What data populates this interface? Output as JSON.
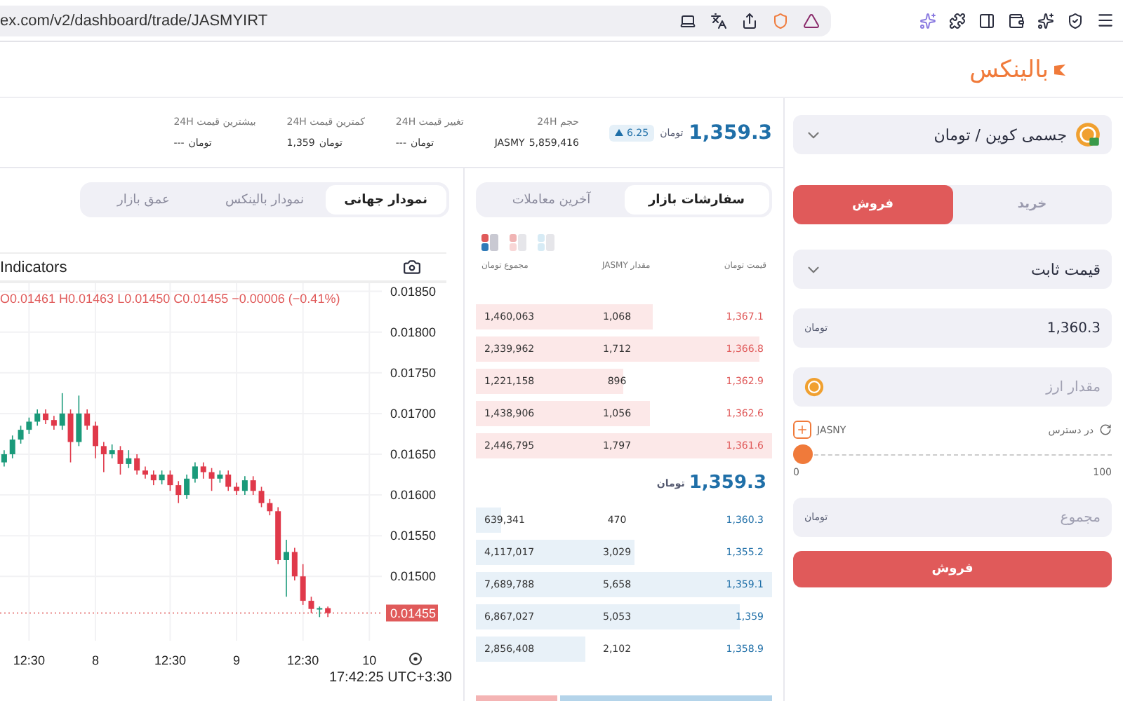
{
  "browser": {
    "url": "ex.com/v2/dashboard/trade/JASMYIRT"
  },
  "logo": {
    "text": "بالینکس"
  },
  "order_form": {
    "pair": "جسمی کوین / تومان",
    "sides": [
      {
        "label": "خرید",
        "selected": false
      },
      {
        "label": "فروش",
        "selected": true
      }
    ],
    "order_type": "قیمت ثابت",
    "price": {
      "value": "1,360.3",
      "unit": "تومان"
    },
    "amount": {
      "placeholder": "مقدار ارز"
    },
    "available": {
      "label": "در دسترس",
      "asset": "JASNY"
    },
    "slider": {
      "level": 0,
      "min": "0",
      "max": "100"
    },
    "total": {
      "placeholder": "مجموع",
      "unit": "تومان"
    },
    "submit": "فروش"
  },
  "ticker": {
    "price": "1,359.3",
    "unit": "تومان",
    "change": "6.25",
    "stats": [
      {
        "label": "حجم 24H",
        "value": "5,859,416",
        "unit": "JASMY",
        "unit_first": false
      },
      {
        "label": "تغییر قیمت 24H",
        "value": "---",
        "unit": "تومان",
        "unit_first": true
      },
      {
        "label": "کمترین قیمت 24H",
        "value": "1,359",
        "unit": "تومان",
        "unit_first": true
      },
      {
        "label": "بیشترین قیمت 24H",
        "value": "---",
        "unit": "تومان",
        "unit_first": true
      }
    ]
  },
  "order_book": {
    "tabs": [
      {
        "label": "سفارشات بازار",
        "selected": true
      },
      {
        "label": "آخرین معاملات",
        "selected": false
      }
    ],
    "view_modes": [
      {
        "kind": "both",
        "selected": true
      },
      {
        "kind": "asks",
        "selected": false
      },
      {
        "kind": "bids",
        "selected": false
      }
    ],
    "columns": [
      {
        "label": "قیمت",
        "unit": "تومان"
      },
      {
        "label": "مقدار",
        "unit": "JASMY"
      },
      {
        "label": "مجموع",
        "unit": "تومان"
      }
    ],
    "asks": [
      {
        "price": "1,367.1",
        "amount": "1,068",
        "total": "1,460,063"
      },
      {
        "price": "1,366.8",
        "amount": "1,712",
        "total": "2,339,962"
      },
      {
        "price": "1,362.9",
        "amount": "896",
        "total": "1,221,158"
      },
      {
        "price": "1,362.6",
        "amount": "1,056",
        "total": "1,438,906"
      },
      {
        "price": "1,361.6",
        "amount": "1,797",
        "total": "2,446,795"
      }
    ],
    "mid": {
      "price": "1,359.3",
      "unit": "تومان"
    },
    "bids": [
      {
        "price": "1,360.3",
        "amount": "470",
        "total": "639,341"
      },
      {
        "price": "1,355.2",
        "amount": "3,029",
        "total": "4,117,017"
      },
      {
        "price": "1,359.1",
        "amount": "5,658",
        "total": "7,689,788"
      },
      {
        "price": "1,359",
        "amount": "5,053",
        "total": "6,867,027"
      },
      {
        "price": "1,358.9",
        "amount": "2,102",
        "total": "2,856,408"
      }
    ]
  },
  "chart_panel": {
    "tabs": [
      {
        "label": "نمودار جهانی",
        "selected": true
      },
      {
        "label": "نمودار بالینکس",
        "selected": false
      },
      {
        "label": "عمق بازار",
        "selected": false
      }
    ],
    "toolbar": "Indicators",
    "legend": "O0.01461 H0.01463 L0.01450 C0.01455 −0.00006 (−0.41%)",
    "time": "17:42:25 UTC+3:30",
    "chart_data": {
      "type": "candlestick",
      "categories": [
        null,
        null,
        null,
        "12:30",
        null,
        null,
        null,
        null,
        null,
        null,
        null,
        "8",
        null,
        null,
        null,
        null,
        null,
        null,
        null,
        null,
        "12:30",
        null,
        null,
        null,
        null,
        null,
        null,
        null,
        "9",
        null,
        null,
        null,
        null,
        null,
        null,
        null,
        "12:30",
        null,
        null,
        null,
        null,
        null,
        null,
        null,
        "10",
        null
      ],
      "ohlc": [
        [
          0.0164,
          0.01655,
          0.01635,
          0.0165
        ],
        [
          0.0165,
          0.01673,
          0.01645,
          0.01668
        ],
        [
          0.01668,
          0.01685,
          0.01663,
          0.0168
        ],
        [
          0.0168,
          0.01695,
          0.01675,
          0.0169
        ],
        [
          0.0169,
          0.01705,
          0.01685,
          0.017
        ],
        [
          0.017,
          0.01705,
          0.01687,
          0.01692
        ],
        [
          0.01692,
          0.01697,
          0.0168,
          0.01685
        ],
        [
          0.01685,
          0.01725,
          0.0168,
          0.017
        ],
        [
          0.017,
          0.01705,
          0.0164,
          0.01665
        ],
        [
          0.01665,
          0.01722,
          0.0166,
          0.017
        ],
        [
          0.017,
          0.01705,
          0.0168,
          0.01685
        ],
        [
          0.01685,
          0.0169,
          0.01645,
          0.0166
        ],
        [
          0.0166,
          0.01665,
          0.01628,
          0.0165
        ],
        [
          0.0165,
          0.01662,
          0.01645,
          0.01655
        ],
        [
          0.01655,
          0.0166,
          0.01625,
          0.01638
        ],
        [
          0.01638,
          0.01655,
          0.01633,
          0.01645
        ],
        [
          0.01645,
          0.0165,
          0.01625,
          0.0163
        ],
        [
          0.0163,
          0.01635,
          0.0162,
          0.01625
        ],
        [
          0.01625,
          0.0163,
          0.01612,
          0.01618
        ],
        [
          0.01618,
          0.0163,
          0.01613,
          0.01625
        ],
        [
          0.01625,
          0.0163,
          0.01605,
          0.01612
        ],
        [
          0.01612,
          0.01617,
          0.0159,
          0.016
        ],
        [
          0.016,
          0.01625,
          0.01595,
          0.0162
        ],
        [
          0.0162,
          0.0164,
          0.01615,
          0.01635
        ],
        [
          0.01635,
          0.0164,
          0.0162,
          0.01628
        ],
        [
          0.01628,
          0.01633,
          0.01605,
          0.0162
        ],
        [
          0.0162,
          0.0163,
          0.01615,
          0.01625
        ],
        [
          0.01625,
          0.0163,
          0.01605,
          0.0161
        ],
        [
          0.0161,
          0.01615,
          0.016,
          0.01605
        ],
        [
          0.01605,
          0.01623,
          0.016,
          0.01618
        ],
        [
          0.01618,
          0.01623,
          0.016,
          0.01605
        ],
        [
          0.01605,
          0.0161,
          0.01585,
          0.0159
        ],
        [
          0.0159,
          0.01595,
          0.01575,
          0.0158
        ],
        [
          0.0158,
          0.01585,
          0.01515,
          0.0152
        ],
        [
          0.0152,
          0.01545,
          0.01475,
          0.0153
        ],
        [
          0.0153,
          0.01535,
          0.01495,
          0.015
        ],
        [
          0.015,
          0.01515,
          0.01465,
          0.0147
        ],
        [
          0.0147,
          0.01475,
          0.01455,
          0.0146
        ],
        [
          0.0146,
          0.01463,
          0.0145,
          0.01461
        ],
        [
          0.01461,
          0.01463,
          0.0145,
          0.01455
        ],
        null,
        null,
        null,
        null,
        null,
        null
      ],
      "yticks": [
        {
          "value": 0.0185,
          "label": "0.01850"
        },
        {
          "value": 0.018,
          "label": "0.01800"
        },
        {
          "value": 0.0175,
          "label": "0.01750"
        },
        {
          "value": 0.017,
          "label": "0.01700"
        },
        {
          "value": 0.0165,
          "label": "0.01650"
        },
        {
          "value": 0.016,
          "label": "0.01600"
        },
        {
          "value": 0.0155,
          "label": "0.01550"
        },
        {
          "value": 0.015,
          "label": "0.01500"
        }
      ],
      "ylim": [
        0.01421,
        0.0186
      ],
      "grid": true,
      "ref_lines": [
        {
          "axis": "y",
          "value": 0.01455,
          "label": "0.01455",
          "color": "#e05a5a"
        }
      ]
    }
  }
}
